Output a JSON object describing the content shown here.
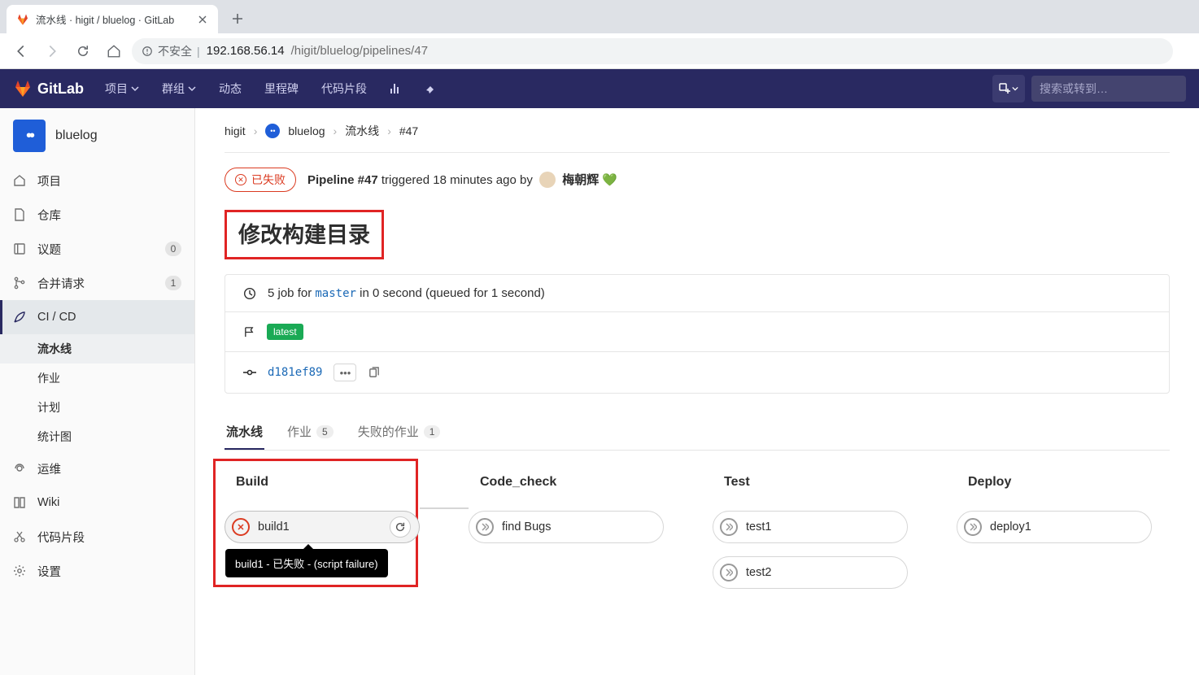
{
  "browser": {
    "tab_title": "流水线 · higit / bluelog · GitLab",
    "url_insecure_label": "不安全",
    "url_host": "192.168.56.14",
    "url_path": "/higit/bluelog/pipelines/47"
  },
  "topnav": {
    "brand": "GitLab",
    "items": [
      "项目",
      "群组",
      "动态",
      "里程碑",
      "代码片段"
    ],
    "search_placeholder": "搜索或转到…"
  },
  "sidebar": {
    "project_name": "bluelog",
    "items": [
      {
        "icon": "home",
        "label": "项目"
      },
      {
        "icon": "file",
        "label": "仓库"
      },
      {
        "icon": "issues",
        "label": "议题",
        "badge": "0"
      },
      {
        "icon": "merge",
        "label": "合并请求",
        "badge": "1"
      },
      {
        "icon": "rocket",
        "label": "CI / CD",
        "active": true,
        "subs": [
          {
            "label": "流水线",
            "active": true
          },
          {
            "label": "作业"
          },
          {
            "label": "计划"
          },
          {
            "label": "统计图"
          }
        ]
      },
      {
        "icon": "ops",
        "label": "运维"
      },
      {
        "icon": "wiki",
        "label": "Wiki"
      },
      {
        "icon": "snippet",
        "label": "代码片段"
      },
      {
        "icon": "gear",
        "label": "设置"
      }
    ]
  },
  "breadcrumb": {
    "group": "higit",
    "project": "bluelog",
    "section": "流水线",
    "id": "#47"
  },
  "pipeline": {
    "status_label": "已失败",
    "title_prefix": "Pipeline #47",
    "triggered_text": "triggered 18 minutes ago by",
    "user": "梅朝辉",
    "commit_title": "修改构建目录",
    "job_summary_prefix": "5 job for",
    "branch": "master",
    "job_summary_suffix": "in 0 second (queued for 1 second)",
    "tag": "latest",
    "commit_sha": "d181ef89"
  },
  "tabs": {
    "pipeline": "流水线",
    "jobs": "作业",
    "jobs_count": "5",
    "failed": "失败的作业",
    "failed_count": "1"
  },
  "stages": {
    "build": {
      "name": "Build",
      "jobs": [
        {
          "name": "build1",
          "status": "fail",
          "tooltip": "build1 - 已失败 - (script failure)"
        }
      ]
    },
    "code_check": {
      "name": "Code_check",
      "jobs": [
        {
          "name": "find Bugs",
          "status": "skip"
        }
      ]
    },
    "test": {
      "name": "Test",
      "jobs": [
        {
          "name": "test1",
          "status": "skip"
        },
        {
          "name": "test2",
          "status": "skip"
        }
      ]
    },
    "deploy": {
      "name": "Deploy",
      "jobs": [
        {
          "name": "deploy1",
          "status": "skip"
        }
      ]
    }
  }
}
